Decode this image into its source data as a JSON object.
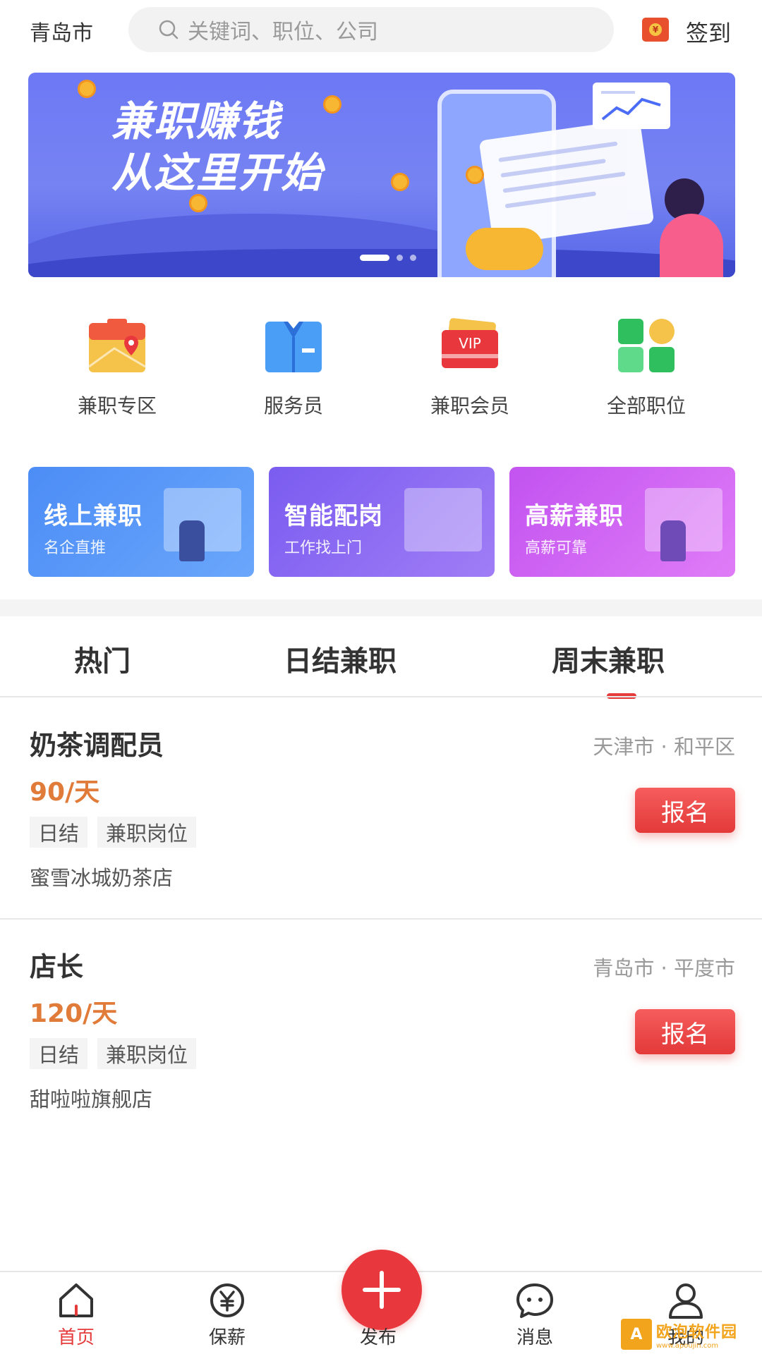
{
  "header": {
    "city": "青岛市",
    "search_placeholder": "关键词、职位、公司",
    "checkin_label": "签到",
    "checkin_coin": "¥"
  },
  "banner": {
    "line1": "兼职赚钱",
    "line2": "从这里开始",
    "slide_count": 3,
    "active_slide": 1
  },
  "categories": [
    {
      "label": "兼职专区",
      "icon": "map-pin-icon"
    },
    {
      "label": "服务员",
      "icon": "uniform-icon"
    },
    {
      "label": "兼职会员",
      "icon": "vip-card-icon",
      "badge": "VIP"
    },
    {
      "label": "全部职位",
      "icon": "grid-icon"
    }
  ],
  "promos": [
    {
      "title": "线上兼职",
      "subtitle": "名企直推",
      "color_from": "#4c8df6",
      "color_to": "#6aa6fb"
    },
    {
      "title": "智能配岗",
      "subtitle": "工作找上门",
      "color_from": "#7a5cf0",
      "color_to": "#a07df6"
    },
    {
      "title": "高薪兼职",
      "subtitle": "高薪可靠",
      "color_from": "#c253f0",
      "color_to": "#e07cf7"
    }
  ],
  "tabs": [
    {
      "label": "热门",
      "active": false
    },
    {
      "label": "日结兼职",
      "active": false
    },
    {
      "label": "周末兼职",
      "active": true
    }
  ],
  "jobs": [
    {
      "title": "奶茶调配员",
      "location": "天津市 · 和平区",
      "salary": "90/天",
      "tags": [
        "日结",
        "兼职岗位"
      ],
      "company": "蜜雪冰城奶茶店",
      "apply_label": "报名"
    },
    {
      "title": "店长",
      "location": "青岛市 · 平度市",
      "salary": "120/天",
      "tags": [
        "日结",
        "兼职岗位"
      ],
      "company": "甜啦啦旗舰店",
      "apply_label": "报名"
    }
  ],
  "bottom_nav": [
    {
      "label": "首页",
      "icon": "home-icon",
      "active": true
    },
    {
      "label": "保薪",
      "icon": "yen-icon",
      "active": false
    },
    {
      "label": "发布",
      "icon": "plus-icon",
      "active": false
    },
    {
      "label": "消息",
      "icon": "message-icon",
      "active": false
    },
    {
      "label": "我的",
      "icon": "user-icon",
      "active": false
    }
  ],
  "watermark": {
    "text": "欧泡软件园",
    "url": "www.apoujin.com"
  },
  "colors": {
    "accent": "#e53b3b",
    "salary": "#e07b39"
  }
}
